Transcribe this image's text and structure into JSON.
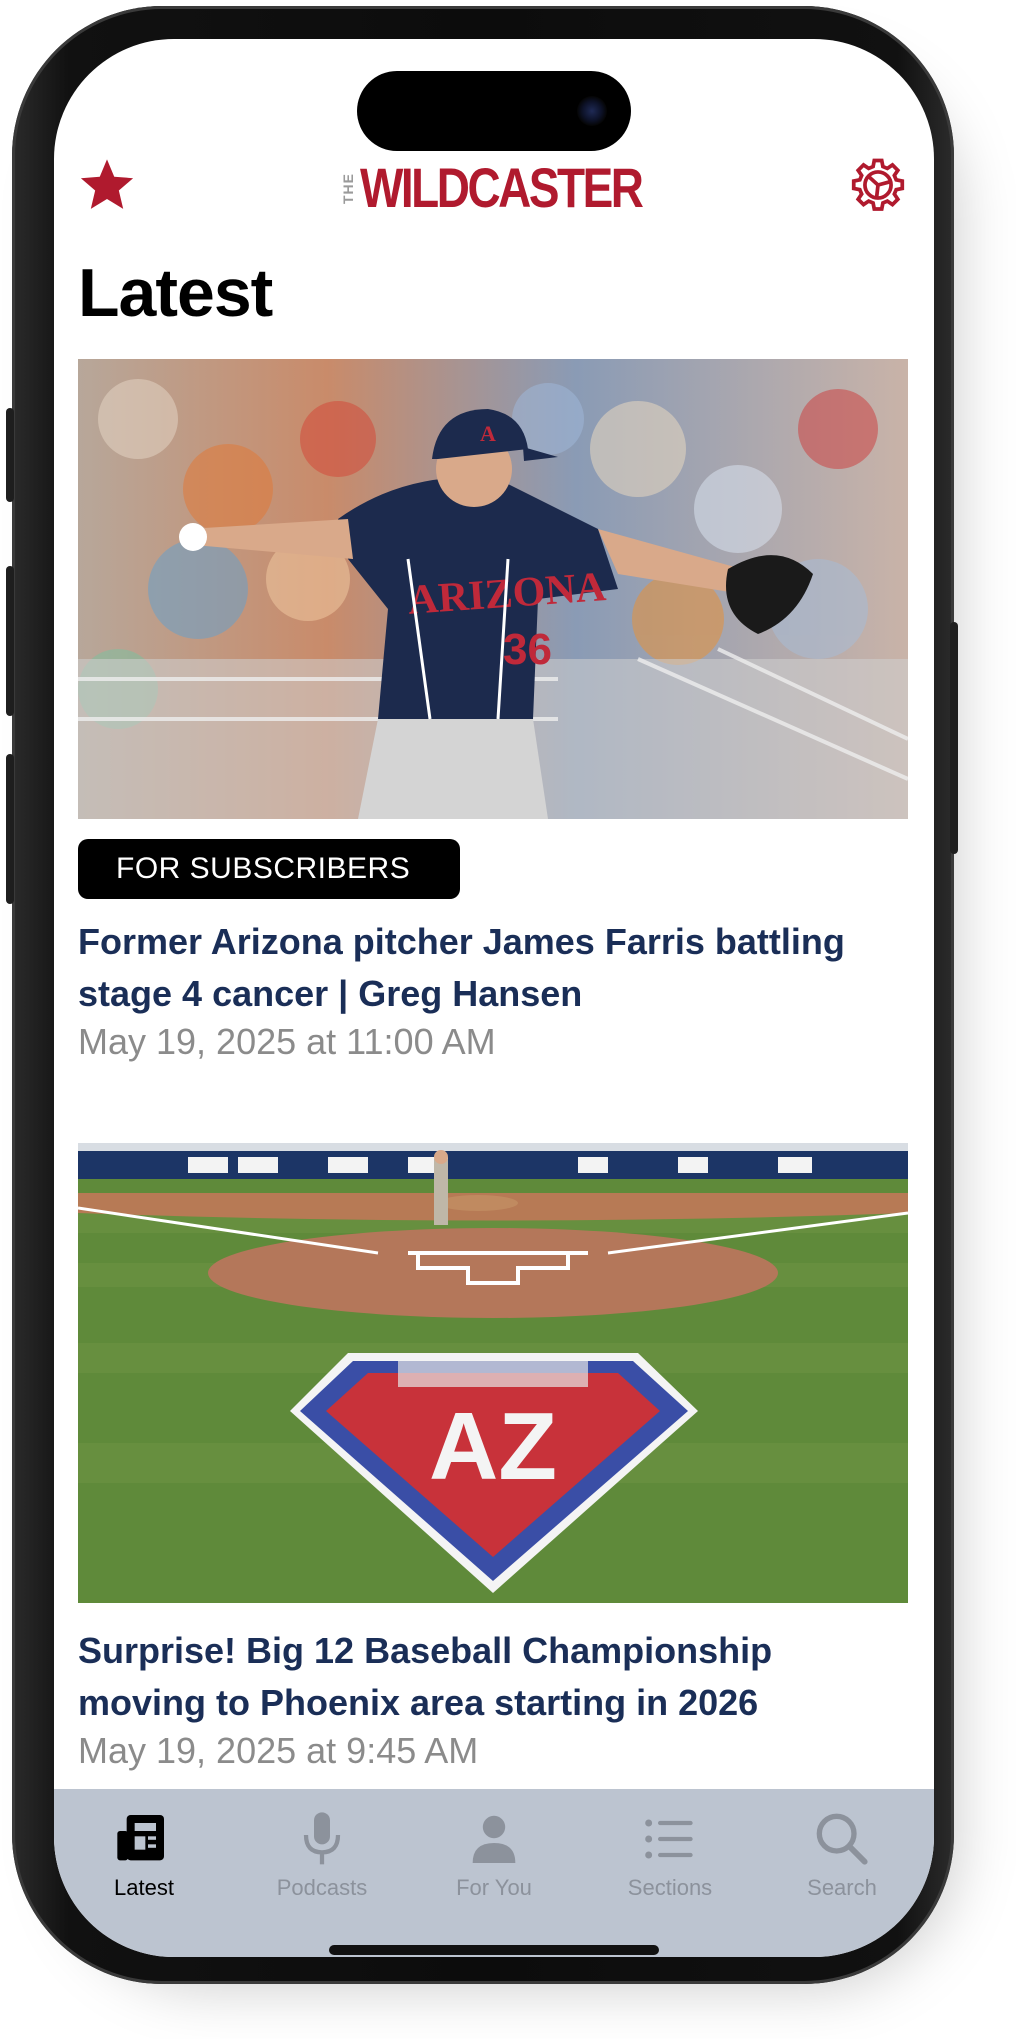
{
  "header": {
    "logo_prefix": "THE",
    "logo_text": "WILDCASTER",
    "favorites_icon": "star-icon",
    "settings_icon": "gear-icon"
  },
  "page": {
    "title": "Latest"
  },
  "articles": [
    {
      "badge": "FOR SUBSCRIBERS",
      "headline": "Former Arizona pitcher James Farris battling stage 4 cancer | Greg Hansen",
      "date": "May 19, 2025 at 11:00 AM",
      "jersey_text": "ARIZONA",
      "jersey_number": "36"
    },
    {
      "headline": "Surprise! Big 12 Baseball Championship moving to Phoenix area starting in 2026",
      "date": "May 19, 2025 at 9:45 AM",
      "field_logo_text": "AZ"
    }
  ],
  "tabs": [
    {
      "label": "Latest",
      "icon": "newspaper-icon",
      "active": true
    },
    {
      "label": "Podcasts",
      "icon": "microphone-icon",
      "active": false
    },
    {
      "label": "For You",
      "icon": "person-icon",
      "active": false
    },
    {
      "label": "Sections",
      "icon": "list-icon",
      "active": false
    },
    {
      "label": "Search",
      "icon": "search-icon",
      "active": false
    }
  ],
  "colors": {
    "brand_red": "#b01a2e",
    "headline_navy": "#1a2e57",
    "tabbar_bg": "#bcc4d0",
    "date_gray": "#8b8b8b"
  }
}
